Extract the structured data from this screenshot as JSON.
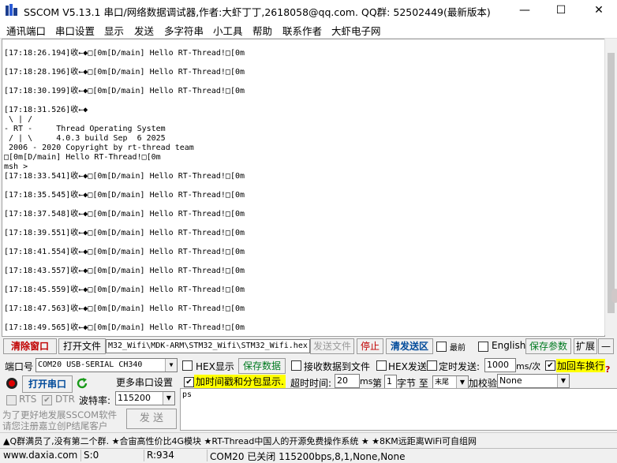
{
  "window": {
    "title": "SSCOM V5.13.1 串口/网络数据调试器,作者:大虾丁丁,2618058@qq.com. QQ群:  52502449(最新版本)",
    "minimize": "—",
    "maximize": "☐",
    "close": "✕"
  },
  "menu": [
    "通讯端口",
    "串口设置",
    "显示",
    "发送",
    "多字符串",
    "小工具",
    "帮助",
    "联系作者",
    "大虾电子网"
  ],
  "receive_lines": [
    "[17:18:26.194]收←◆□[0m[D/main] Hello RT-Thread!□[0m",
    "[17:18:28.196]收←◆□[0m[D/main] Hello RT-Thread!□[0m",
    "[17:18:30.199]收←◆□[0m[D/main] Hello RT-Thread!□[0m",
    "[17:18:31.526]收←◆",
    " \\ | /",
    "- RT -     Thread Operating System",
    " / | \\     4.0.3 build Sep  6 2025",
    " 2006 - 2020 Copyright by rt-thread team",
    "□[0m[D/main] Hello RT-Thread!□[0m",
    "msh >",
    "[17:18:33.541]收←◆□[0m[D/main] Hello RT-Thread!□[0m",
    "[17:18:35.545]收←◆□[0m[D/main] Hello RT-Thread!□[0m",
    "[17:18:37.548]收←◆□[0m[D/main] Hello RT-Thread!□[0m",
    "[17:18:39.551]收←◆□[0m[D/main] Hello RT-Thread!□[0m",
    "[17:18:41.554]收←◆□[0m[D/main] Hello RT-Thread!□[0m",
    "[17:18:43.557]收←◆□[0m[D/main] Hello RT-Thread!□[0m",
    "[17:18:45.559]收←◆□[0m[D/main] Hello RT-Thread!□[0m",
    "[17:18:47.563]收←◆□[0m[D/main] Hello RT-Thread!□[0m",
    "[17:18:49.565]收←◆□[0m[D/main] Hello RT-Thread!□[0m"
  ],
  "toolbar1": {
    "clear_window": "清除窗口",
    "open_file": "打开文件",
    "file_path": "M32_Wifi\\MDK-ARM\\STM32_Wifi\\STM32_Wifi.hex",
    "send_file": "发送文件",
    "stop": "停止",
    "clear_send": "清发送区",
    "topmost": "最前",
    "english": "English",
    "save_params": "保存参数",
    "expand": "扩展",
    "collapse": "—"
  },
  "row2": {
    "port_label": "端口号",
    "port_value": "COM20 USB-SERIAL CH340",
    "hex_display": "HEX显示",
    "save_data": "保存数据",
    "recv_to_file": "接收数据到文件",
    "hex_send": "HEX发送",
    "timed_send": "定时发送:",
    "interval": "1000",
    "interval_unit": "ms/次",
    "add_crlf": "加回车换行",
    "help_mark": "?"
  },
  "row3": {
    "open_port": "打开串口",
    "more_settings": "更多串口设置",
    "timestamp": "加时间戳和分包显示.",
    "timeout_label": "超时时间:",
    "timeout": "20",
    "timeout_unit": "ms",
    "nth_label": "第",
    "byte_index": "1",
    "byte_label": "字节 至",
    "end_value": "末尾",
    "checksum_label": "加校验",
    "checksum_value": "None"
  },
  "row4": {
    "rts": "RTS",
    "dtr": "DTR",
    "baud_label": "波特率:",
    "baud_value": "115200"
  },
  "promo": {
    "line1": "为了更好地发展SSCOM软件",
    "line2": "请您注册嘉立创P结尾客户"
  },
  "send_button": "发 送",
  "send_text": "ps",
  "adbar": "▲Q群满员了,没有第二个群. ★合宙高性价比4G模块 ★RT-Thread中国人的开源免费操作系统 ★ ★8KM远距离WiFi可自组网",
  "status": {
    "site": "www.daxia.com",
    "sent": "S:0",
    "received": "R:934",
    "port_status": "COM20 已关闭  115200bps,8,1,None,None"
  }
}
